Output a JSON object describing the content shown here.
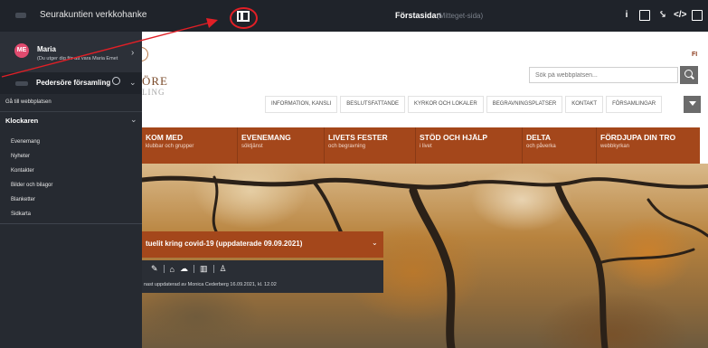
{
  "topbar": {
    "brand": "Seurakuntien verkkohanke",
    "page_title": "Förstasidan",
    "page_subtitle": "(Mitteget-sida)",
    "icons": [
      "info-icon",
      "page-icon",
      "person-icon",
      "code-icon",
      "grid-icon"
    ]
  },
  "sidebar": {
    "user": {
      "initials": "ME",
      "name": "Maria",
      "note": "(Du utger dig för att vara Maria Emet"
    },
    "site": {
      "name": "Pedersöre församling"
    },
    "back_link": "Gå till webbplatsen",
    "section": "Klockaren",
    "items": [
      "Evenemang",
      "Nyheter",
      "Kontakter",
      "Bilder och bilagor",
      "Blanketter",
      "Sidkarta"
    ]
  },
  "header": {
    "logo_text": "ÖRE",
    "logo_sub": "LING",
    "lang": "FI",
    "search_placeholder": "Sök på webbplatsen...",
    "quicklinks": [
      "INFORMATION, KANSLI",
      "BESLUTSFATTANDE",
      "KYRKOR OCH LOKALER",
      "BEGRAVNINGSPLATSER",
      "KONTAKT",
      "FÖRSAMLINGAR"
    ]
  },
  "nav": [
    {
      "title": "KOM MED",
      "sub": "klubbar och grupper"
    },
    {
      "title": "EVENEMANG",
      "sub": "söktjänst"
    },
    {
      "title": "LIVETS FESTER",
      "sub": "och begravning"
    },
    {
      "title": "STÖD OCH HJÄLP",
      "sub": "i livet"
    },
    {
      "title": "DELTA",
      "sub": "och påverka"
    },
    {
      "title": "FÖRDJUPA DIN TRO",
      "sub": "webbkyrkan"
    }
  ],
  "notice": {
    "title": "tuelit kring covid-19 (uppdaterade 09.09.2021)",
    "updated": "nast uppdaterad av Monica Cederberg 16.09.2021, kl. 12.02"
  },
  "colors": {
    "accent": "#a4471b",
    "admin_bar": "#1f232a",
    "annotation": "#e11f26"
  }
}
